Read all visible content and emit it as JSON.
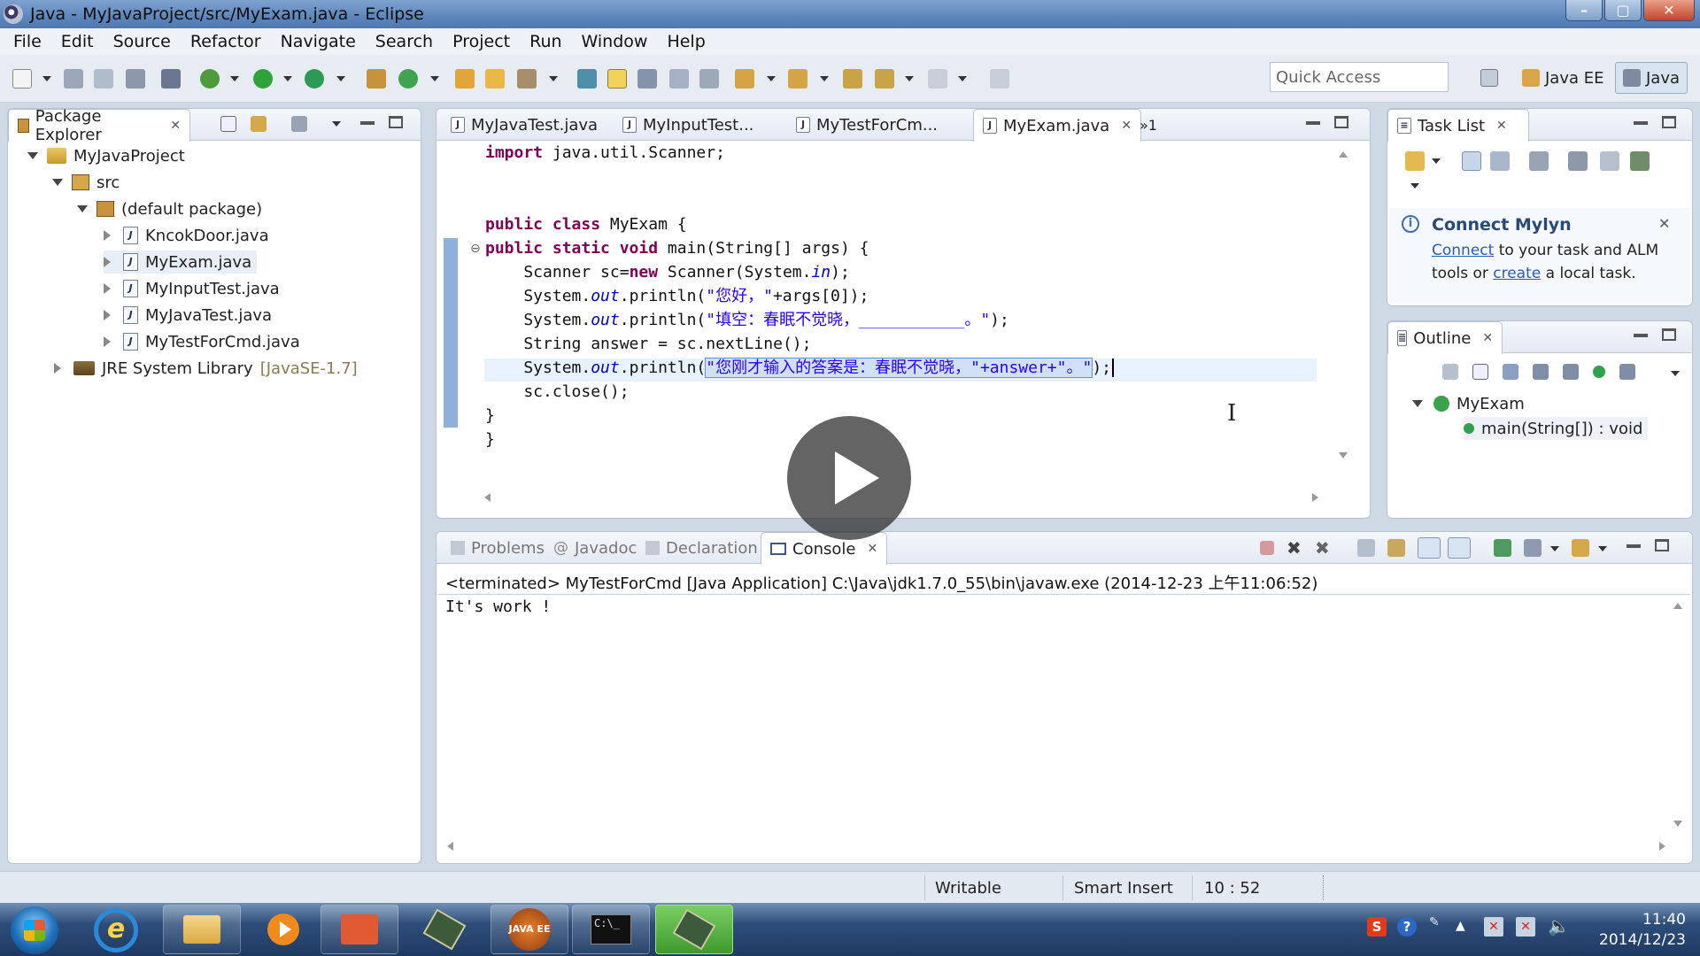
{
  "window": {
    "title": "Java - MyJavaProject/src/MyExam.java - Eclipse"
  },
  "menu": [
    "File",
    "Edit",
    "Source",
    "Refactor",
    "Navigate",
    "Search",
    "Project",
    "Run",
    "Window",
    "Help"
  ],
  "toolbar": {
    "quick_access_placeholder": "Quick Access",
    "perspectives": [
      "Java EE",
      "Java"
    ]
  },
  "package_explorer": {
    "tab": "Package Explorer",
    "project": "MyJavaProject",
    "src": "src",
    "package": "(default package)",
    "files": [
      "KncokDoor.java",
      "MyExam.java",
      "MyInputTest.java",
      "MyJavaTest.java",
      "MyTestForCmd.java"
    ],
    "library": "JRE System Library",
    "library_version": "[JavaSE-1.7]"
  },
  "editor": {
    "tabs": [
      "MyJavaTest.java",
      "MyInputTest...",
      "MyTestForCm...",
      "MyExam.java"
    ],
    "overflow": "»1",
    "lines": {
      "l1_kw": "import",
      "l1_rest": " java.util.Scanner;",
      "l4_kw": "public class",
      "l4_rest": " MyExam {",
      "l5_kw": "public static void",
      "l5_rest": " main(String[] args) {",
      "l6_a": "    Scanner sc=",
      "l6_kw": "new",
      "l6_b": " Scanner(System.",
      "l6_it": "in",
      "l6_c": ");",
      "l7_a": "    System.",
      "l7_it": "out",
      "l7_b": ".println(",
      "l7_str": "\"您好，\"",
      "l7_c": "+args[0]);",
      "l8_a": "    System.",
      "l8_it": "out",
      "l8_b": ".println(",
      "l8_str": "\"填空：春眠不觉晓，___________。\"",
      "l8_c": ");",
      "l9": "    String answer = sc.nextLine();",
      "l10_a": "    System.",
      "l10_it": "out",
      "l10_b": ".println(",
      "l10_str": "\"您刚才输入的答案是：春眠不觉晓，\"+answer+\"。\"",
      "l10_c": ");",
      "l11": "    sc.close();",
      "l12": "}",
      "l13": "}"
    }
  },
  "task_list": {
    "tab": "Task List",
    "mylyn_title": "Connect Mylyn",
    "mylyn_connect": "Connect",
    "mylyn_text1": " to your task and ALM",
    "mylyn_text2": "tools or ",
    "mylyn_create": "create",
    "mylyn_text3": " a local task."
  },
  "outline": {
    "tab": "Outline",
    "class": "MyExam",
    "method": "main(String[]) : void"
  },
  "bottom": {
    "tabs": [
      "Problems",
      "Javadoc",
      "Declaration",
      "Console"
    ],
    "console_header": "<terminated> MyTestForCmd [Java Application] C:\\Java\\jdk1.7.0_55\\bin\\javaw.exe (2014-12-23 上午11:06:52)",
    "console_output": "It's work !"
  },
  "status": {
    "writable": "Writable",
    "insert": "Smart Insert",
    "position": "10 : 52"
  },
  "taskbar": {
    "time": "11:40",
    "date": "2014/12/23"
  }
}
